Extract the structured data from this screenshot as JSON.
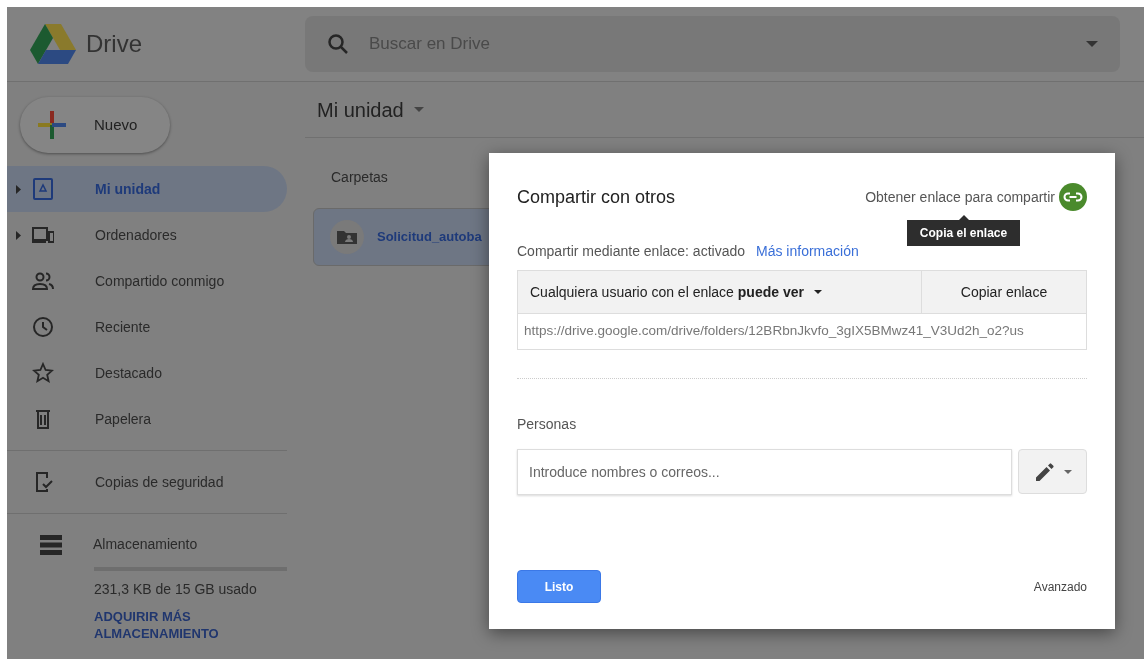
{
  "app": {
    "name": "Drive"
  },
  "search": {
    "placeholder": "Buscar en Drive"
  },
  "new_button": {
    "label": "Nuevo"
  },
  "sidebar": {
    "items": [
      {
        "label": "Mi unidad",
        "expandable": true,
        "selected": true
      },
      {
        "label": "Ordenadores",
        "expandable": true,
        "selected": false
      },
      {
        "label": "Compartido conmigo",
        "expandable": false,
        "selected": false
      },
      {
        "label": "Reciente",
        "expandable": false,
        "selected": false
      },
      {
        "label": "Destacado",
        "expandable": false,
        "selected": false
      },
      {
        "label": "Papelera",
        "expandable": false,
        "selected": false
      },
      {
        "label": "Copias de seguridad",
        "expandable": false,
        "selected": false
      }
    ],
    "storage": {
      "label": "Almacenamiento",
      "usage": "231,3 KB de 15 GB usado",
      "link": "ADQUIRIR MÁS ALMACENAMIENTO"
    }
  },
  "main": {
    "title": "Mi unidad",
    "section": "Carpetas",
    "folders": [
      {
        "name": "Solicitud_autoba"
      }
    ]
  },
  "dialog": {
    "title": "Compartir con otros",
    "get_link": "Obtener enlace para compartir",
    "tooltip": "Copia el enlace",
    "link_status": "Compartir mediante enlace: activado",
    "more_info": "Más información",
    "access": "Cualquiera usuario con el enlace **puede ver**",
    "copy_button": "Copiar enlace",
    "url": "https://drive.google.com/drive/folders/12BRbnJkvfo_3gIX5BMwz41_V3Ud2h_o2?us",
    "people_label": "Personas",
    "people_placeholder": "Introduce nombres o correos...",
    "done_button": "Listo",
    "advanced": "Avanzado"
  }
}
